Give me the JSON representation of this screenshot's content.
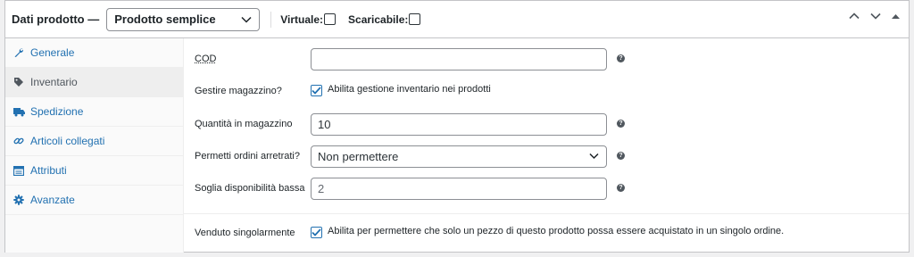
{
  "header": {
    "title": "Dati prodotto —",
    "product_type": "Prodotto semplice",
    "virtual_label": "Virtuale:",
    "downloadable_label": "Scaricabile:"
  },
  "tabs": [
    {
      "label": "Generale",
      "icon": "wrench-icon"
    },
    {
      "label": "Inventario",
      "icon": "tag-icon"
    },
    {
      "label": "Spedizione",
      "icon": "truck-icon"
    },
    {
      "label": "Articoli collegati",
      "icon": "link-icon"
    },
    {
      "label": "Attributi",
      "icon": "table-icon"
    },
    {
      "label": "Avanzate",
      "icon": "gear-icon"
    }
  ],
  "fields": {
    "sku": {
      "label": "COD",
      "value": ""
    },
    "manage_stock": {
      "label": "Gestire magazzino?",
      "text": "Abilita gestione inventario nei prodotti"
    },
    "quantity": {
      "label": "Quantità in magazzino",
      "value": "10"
    },
    "backorders": {
      "label": "Permetti ordini arretrati?",
      "value": "Non permettere"
    },
    "low_stock": {
      "label": "Soglia disponibilità bassa",
      "placeholder": "2"
    },
    "sold_individually": {
      "label": "Venduto singolarmente",
      "text": "Abilita per permettere che solo un pezzo di questo prodotto possa essere acquistato in un singolo ordine."
    }
  },
  "help_glyph": "?",
  "colors": {
    "accent": "#2271b1",
    "border": "#c3c4c7",
    "active_tab_bg": "#eeeeee"
  }
}
